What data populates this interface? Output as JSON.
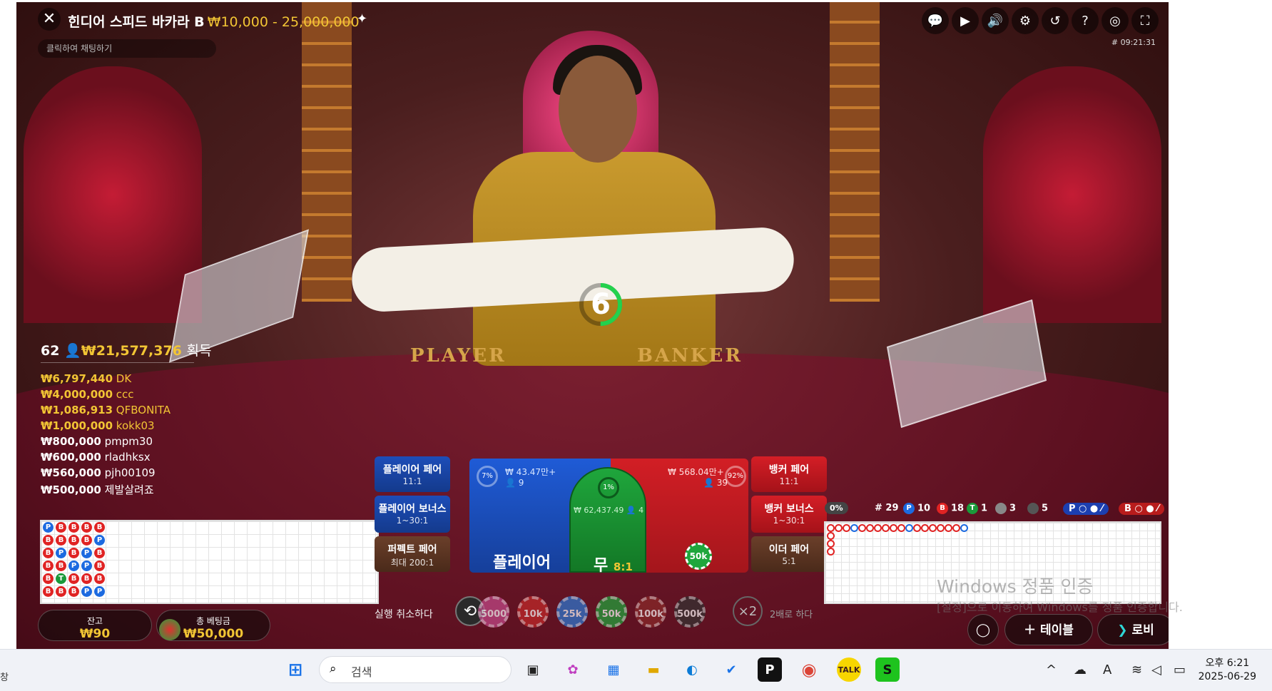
{
  "header": {
    "title": "힌디어 스피드 바카라 B",
    "limits": "₩10,000 - 25,000,000",
    "chat_placeholder": "클릭하여 채팅하기",
    "game_id": "# 09:21:31"
  },
  "toolbar_icons": [
    "chat-icon",
    "video-icon",
    "volume-icon",
    "settings-icon",
    "history-icon",
    "help-icon",
    "headset-icon",
    "fullscreen-icon"
  ],
  "timer": {
    "value": "6"
  },
  "winners": {
    "count": "62",
    "total": "₩21,577,376",
    "label": "획득",
    "list": [
      {
        "amount": "₩6,797,440",
        "name": "DK"
      },
      {
        "amount": "₩4,000,000",
        "name": "ccc"
      },
      {
        "amount": "₩1,086,913",
        "name": "QFBONITA"
      },
      {
        "amount": "₩1,000,000",
        "name": "kokk03"
      },
      {
        "amount": "₩800,000",
        "name": "pmpm30"
      },
      {
        "amount": "₩600,000",
        "name": "rladhksx"
      },
      {
        "amount": "₩560,000",
        "name": "pjh00109"
      },
      {
        "amount": "₩500,000",
        "name": "제발살려죠"
      }
    ]
  },
  "felt": {
    "player": "PLAYER",
    "banker": "BANKER"
  },
  "bets": {
    "player_pair": {
      "label": "플레이어 페어",
      "odds": "11:1"
    },
    "player_bonus": {
      "label": "플레이어 보너스",
      "odds": "1~30:1"
    },
    "perfect_pair": {
      "label": "퍼펙트 페어",
      "odds": "최대 200:1"
    },
    "banker_pair": {
      "label": "뱅커 페어",
      "odds": "11:1"
    },
    "banker_bonus": {
      "label": "뱅커 보너스",
      "odds": "1~30:1"
    },
    "either_pair": {
      "label": "이더 페어",
      "odds": "5:1"
    },
    "player": {
      "label": "플레이어",
      "amount": "₩ 43.47만+",
      "players": "9",
      "pct": "7%"
    },
    "tie": {
      "label": "무",
      "odds": "8:1",
      "amount": "₩ 62,437.49",
      "players": "4",
      "pct": "1%"
    },
    "banker": {
      "amount": "₩ 568.04만+",
      "players": "39",
      "pct": "92%",
      "chip": "50k"
    }
  },
  "chips": {
    "undo_label": "실행 취소하다",
    "values": [
      "5000",
      "10k",
      "25k",
      "50k",
      "100k",
      "500k"
    ],
    "double": "×2",
    "double_label": "2배로 하다"
  },
  "stats": {
    "zero": "0%",
    "rounds": "# 29",
    "player": "10",
    "banker": "18",
    "tie": "1",
    "player_pair": "3",
    "banker_pair": "5",
    "p_pred": "P",
    "b_pred": "B"
  },
  "bead_road": [
    [
      "P",
      "B",
      "B",
      "B",
      "B"
    ],
    [
      "B",
      "B",
      "B",
      "B",
      "P"
    ],
    [
      "B",
      "P",
      "B",
      "P",
      "B"
    ],
    [
      "B",
      "B",
      "P",
      "P",
      "B"
    ],
    [
      "B",
      "T",
      "B",
      "B",
      "B"
    ],
    [
      "B",
      "B",
      "B",
      "P",
      "P"
    ],
    [
      "P",
      "P",
      "P",
      "B",
      ""
    ]
  ],
  "footer": {
    "balance_label": "잔고",
    "balance": "₩90",
    "total_bet_label": "총 베팅금",
    "total_bet": "₩50,000",
    "table_btn": "테이블",
    "lobby_btn": "로비"
  },
  "watermark": {
    "title": "Windows 정품 인증",
    "subtitle": "[설정]으로 이동하여 Windows를 정품 인증합니다."
  },
  "taskbar": {
    "search_placeholder": "검색",
    "left_edge": "창",
    "time": "오후 6:21",
    "date": "2025-06-29",
    "ime": "A"
  },
  "colors": {
    "player": "#1c6ae0",
    "banker": "#e02323",
    "tie": "#1a9a3a",
    "gold": "#f2c534"
  }
}
